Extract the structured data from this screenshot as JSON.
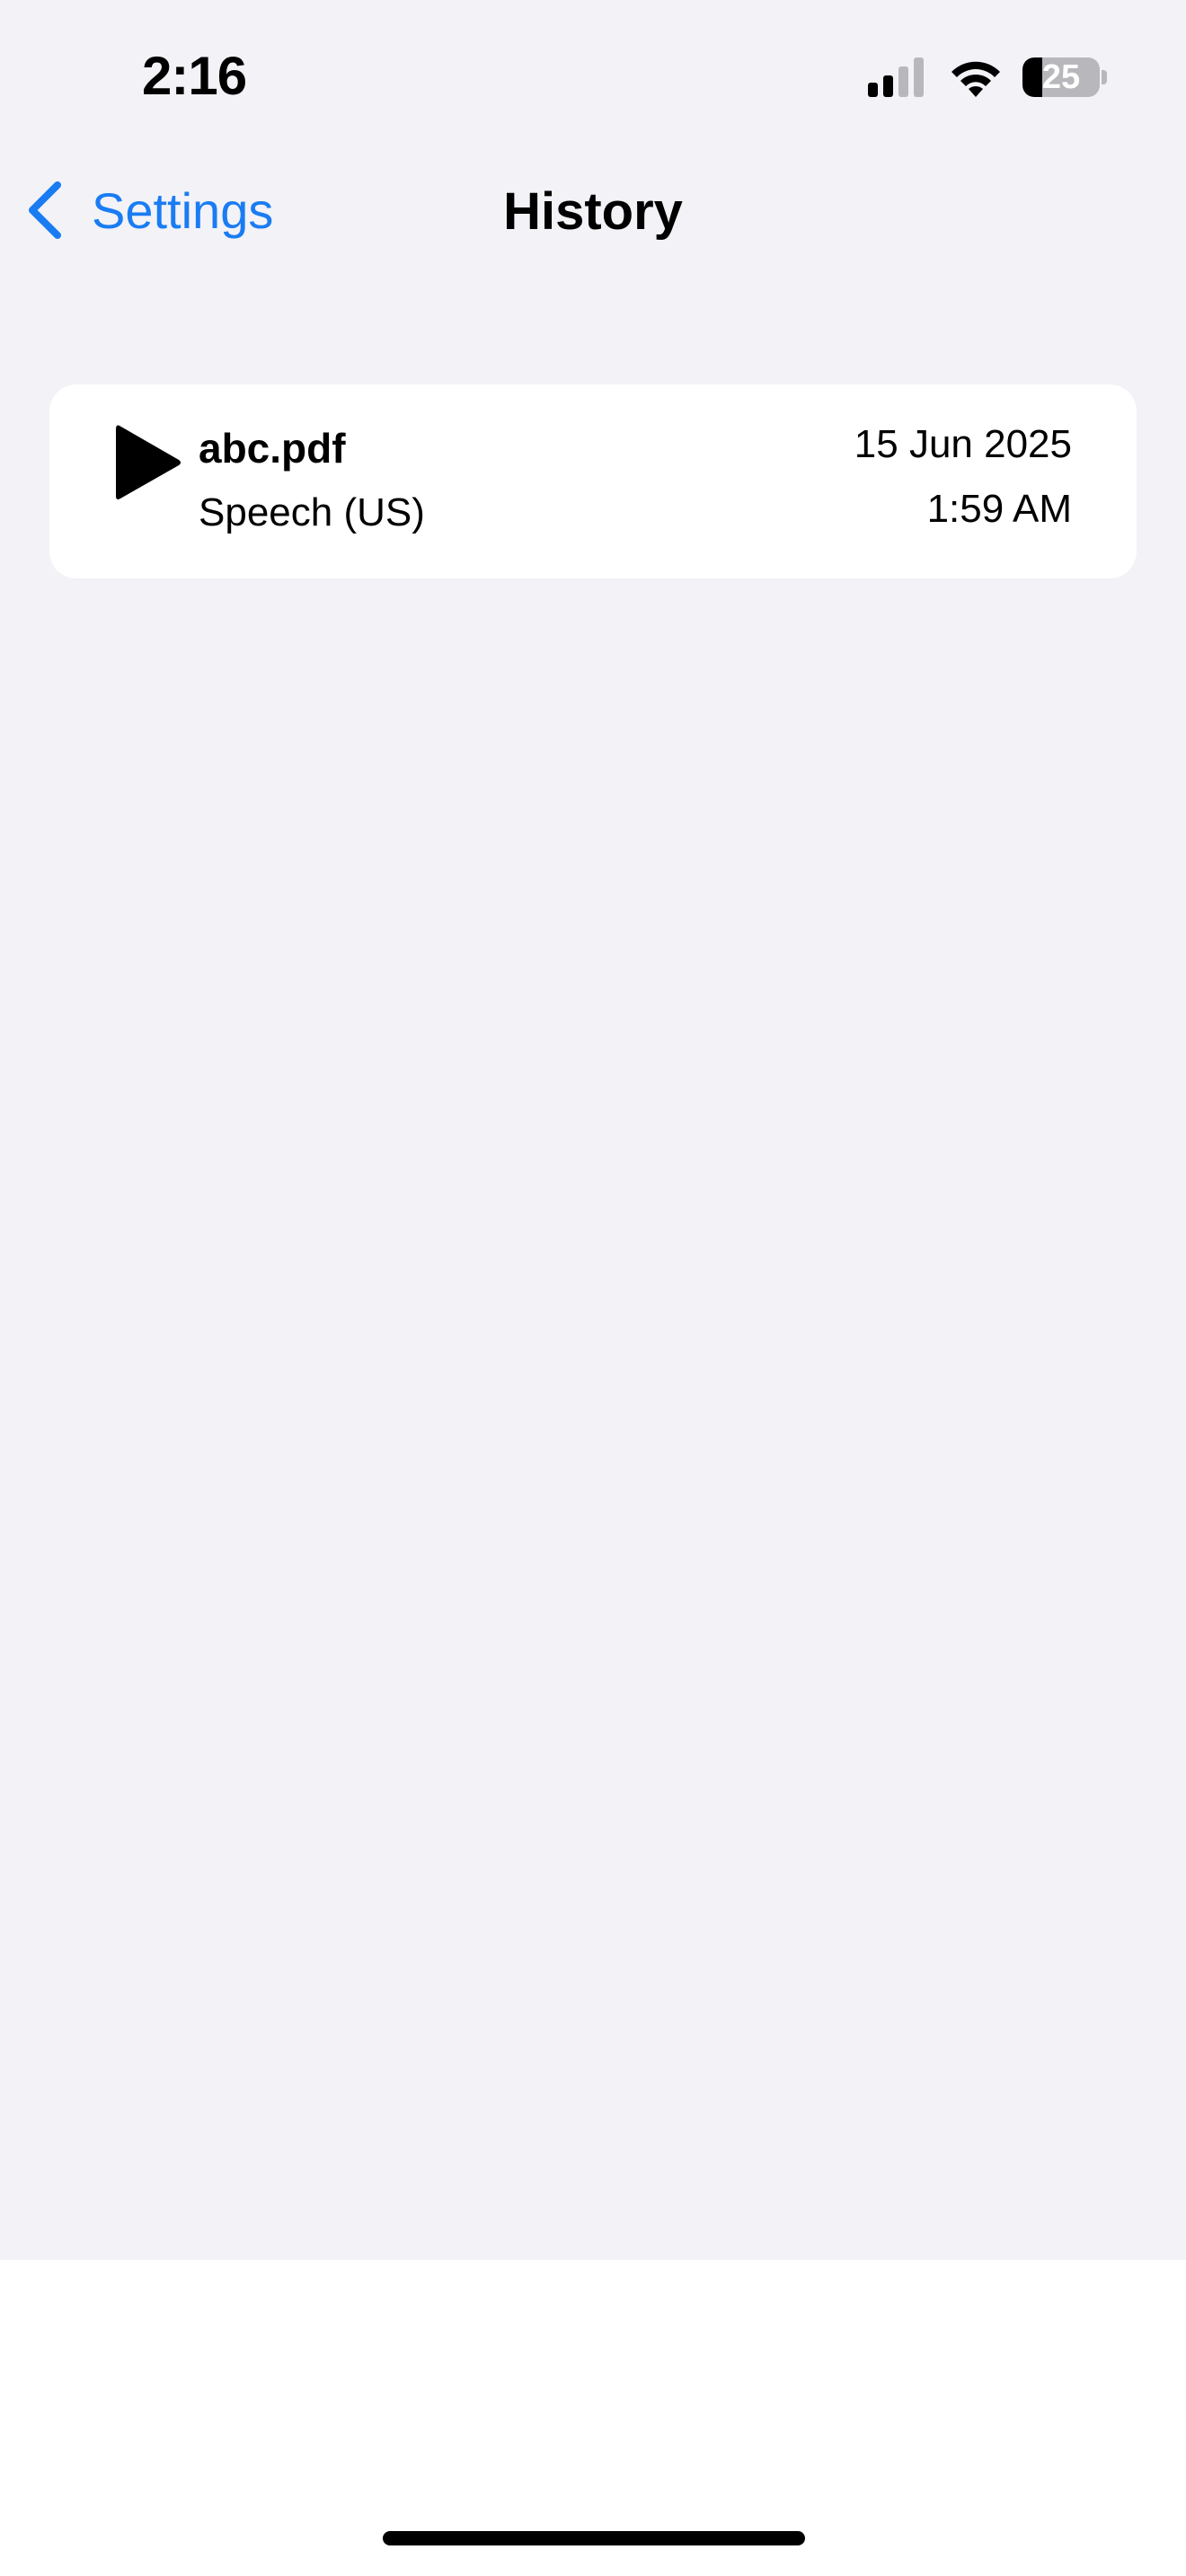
{
  "status_bar": {
    "time": "2:16",
    "battery_level": "25",
    "icons": [
      "cellular-signal-icon",
      "wifi-icon",
      "battery-icon"
    ]
  },
  "nav": {
    "back_label": "Settings",
    "title": "History"
  },
  "history": {
    "items": [
      {
        "file_name": "abc.pdf",
        "voice": "Speech (US)",
        "date": "15 Jun 2025",
        "time": "1:59 AM",
        "icon": "play-icon"
      }
    ]
  },
  "colors": {
    "accent": "#1a7cf2",
    "background": "#f2f2f7",
    "card": "#ffffff"
  }
}
